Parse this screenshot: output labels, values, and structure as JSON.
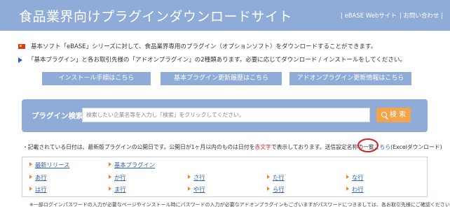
{
  "header": {
    "title": "食品業界向けプラグインダウンロードサイト",
    "links": [
      "| eBASE Webサイト",
      "| お問い合わせ |"
    ]
  },
  "intro": {
    "line1": "基本ソフト「eBASE」シリーズに対して、食品業界専用のプラグイン（オプションソフト）をダウンロードすることができます。",
    "line2": "「基本プラグイン」と各お取引先様の「アドオンプラグイン」の2種類あります。必要に応じてダウンロード / インストールをしてください。"
  },
  "buttons": {
    "install": "インストール手順はこちら",
    "basic_history": "基本プラグイン更新履歴はこちら",
    "addon_info": "アドオンプラグイン更新情報はこちら"
  },
  "search": {
    "label": "プラグイン検索",
    "placeholder": "検索したい企業名等を入力し「検索」をクリックしてください。",
    "button": "検 索"
  },
  "notice": {
    "text_before": "・記載されている日付は、最新版プラグインの公開日です。公開日が1ヶ月以内のものは日付を",
    "red_text": "赤文字",
    "text_middle": "で表示しております。送信設定名称の一覧",
    "link_text": "こちら",
    "text_after": "(Excelダウンロード)"
  },
  "index": {
    "latest": "最新リリース",
    "basic": "基本プラグイン",
    "row1": [
      "あ行",
      "か行",
      "さ行",
      "た行",
      "な行"
    ],
    "row2": [
      "は行",
      "ま行",
      "や行",
      "ら行",
      "わ行"
    ]
  },
  "footnote": "※一部ログインパスワードの入力が必要なページやインストール時にパスワードの入力が必要なアドオンプラグインもございますがパスワードにつきましては、各お取引先様にご確認ください。",
  "colors": {
    "header_blue": "#8facd9",
    "link_blue": "#2f62b8",
    "search_orange": "#f3a34a",
    "highlight_red": "#d21f1f"
  }
}
